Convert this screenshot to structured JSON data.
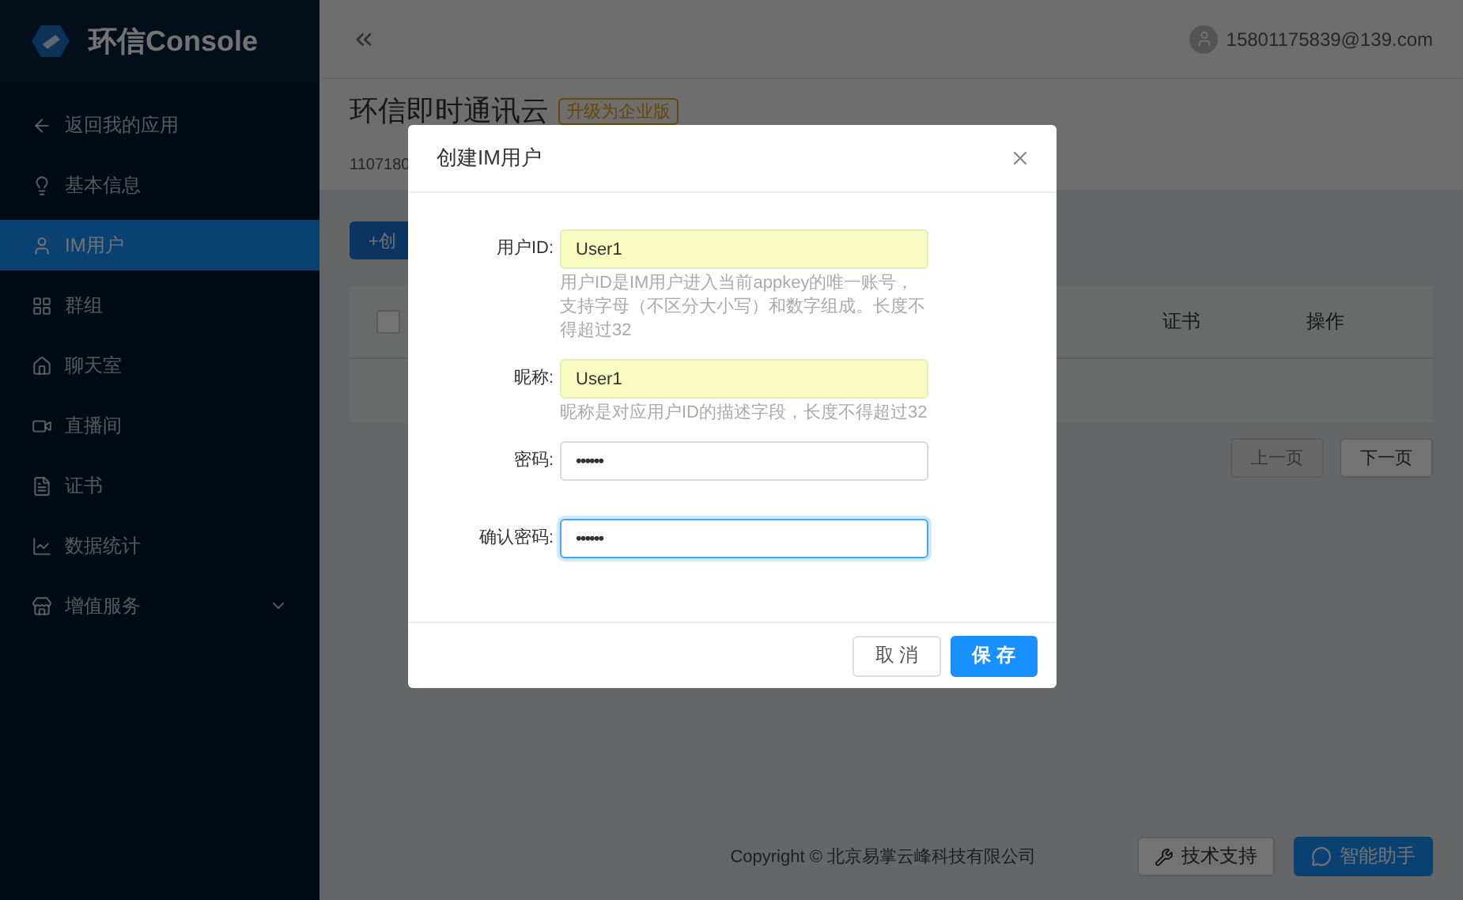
{
  "sidebar": {
    "logo": "环信Console",
    "items": [
      {
        "label": "返回我的应用",
        "selected": false
      },
      {
        "label": "基本信息",
        "selected": false
      },
      {
        "label": "IM用户",
        "selected": true
      },
      {
        "label": "群组",
        "selected": false
      },
      {
        "label": "聊天室",
        "selected": false
      },
      {
        "label": "直播间",
        "selected": false
      },
      {
        "label": "证书",
        "selected": false
      },
      {
        "label": "数据统计",
        "selected": false
      },
      {
        "label": "增值服务",
        "selected": false,
        "expanded": false
      }
    ]
  },
  "header": {
    "user": "15801175839@139.com"
  },
  "app": {
    "title": "环信即时通讯云",
    "badge": "升级为企业版",
    "appkey": "1107180"
  },
  "create_button": "+创",
  "table": {
    "select_all_checked": false,
    "columns": [
      "证书",
      "操作"
    ]
  },
  "pagination": [
    {
      "label": "上一页",
      "disabled": true
    },
    {
      "label": "下一页",
      "disabled": false
    }
  ],
  "footer": {
    "copyright": "Copyright © 北京易掌云峰科技有限公司",
    "buttons": [
      {
        "label": "技术支持",
        "kind": "default"
      },
      {
        "label": "智能助手",
        "kind": "primary"
      }
    ]
  },
  "dialog": {
    "title": "创建IM用户",
    "fields": [
      {
        "label": "用户ID:",
        "value": "User1",
        "kind": "text",
        "autofilled": true,
        "focused": false,
        "hint": "用户ID是IM用户进入当前appkey的唯一账号，支持字母（不区分大小写）和数字组成。长度不得超过32"
      },
      {
        "label": "昵称:",
        "value": "User1",
        "kind": "text",
        "autofilled": true,
        "focused": false,
        "hint": "昵称是对应用户ID的描述字段，长度不得超过32"
      },
      {
        "label": "密码:",
        "value": "••••••",
        "kind": "password",
        "autofilled": false,
        "focused": false
      },
      {
        "label": "确认密码:",
        "value": "••••••",
        "kind": "password",
        "autofilled": false,
        "focused": true
      }
    ],
    "buttons": [
      {
        "label": "取 消",
        "kind": "default"
      },
      {
        "label": "保 存",
        "kind": "primary"
      }
    ]
  }
}
